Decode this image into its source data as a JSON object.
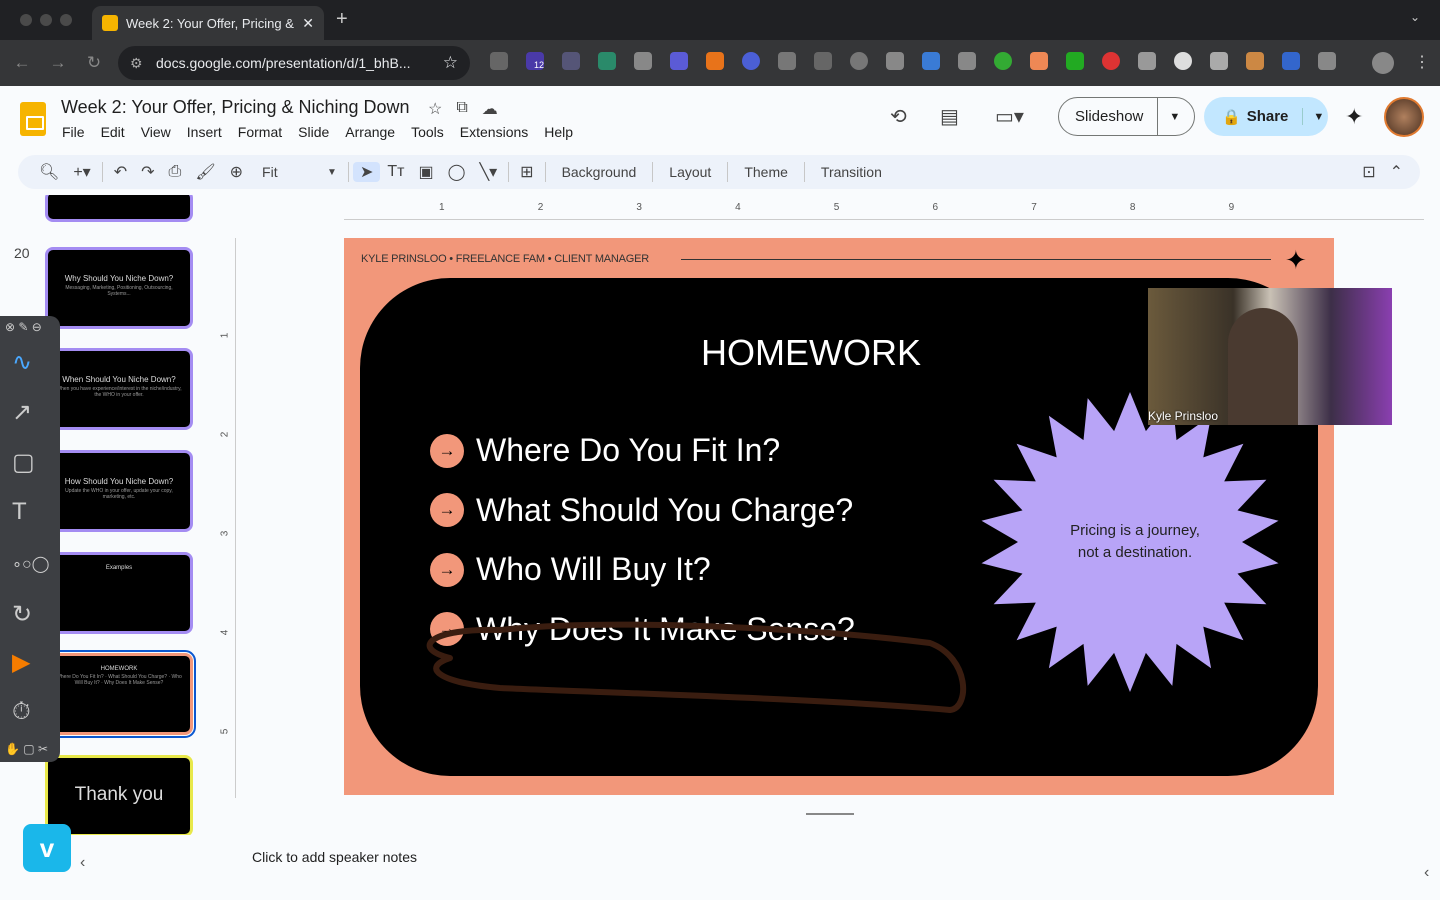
{
  "browser": {
    "tab_title": "Week 2: Your Offer, Pricing &",
    "url": "docs.google.com/presentation/d/1_bhB...",
    "extension_badge": "12"
  },
  "doc": {
    "title": "Week 2: Your Offer, Pricing & Niching Down",
    "menu": [
      "File",
      "Edit",
      "View",
      "Insert",
      "Format",
      "Slide",
      "Arrange",
      "Tools",
      "Extensions",
      "Help"
    ],
    "slideshow_label": "Slideshow",
    "share_label": "Share"
  },
  "toolbar": {
    "zoom": "Fit",
    "buttons": [
      "Background",
      "Layout",
      "Theme",
      "Transition"
    ]
  },
  "filmstrip": {
    "slide_number": "20",
    "thumbs": [
      {
        "title": "",
        "sub": ""
      },
      {
        "title": "Why Should You Niche Down?",
        "sub": "Messaging, Marketing, Positioning, Outsourcing, Systems..."
      },
      {
        "title": "When Should You Niche Down?",
        "sub": "When you have experience/interest in the niche/industry, the WHO in your offer."
      },
      {
        "title": "How Should You Niche Down?",
        "sub": "Update the WHO in your offer, update your copy, marketing, etc."
      },
      {
        "title": "Examples",
        "sub": ""
      },
      {
        "title": "HOMEWORK",
        "sub": "Where Do You Fit In? · What Should You Charge? · Who Will Buy It? · Why Does It Make Sense?"
      },
      {
        "title": "Thank you",
        "sub": ""
      }
    ]
  },
  "ruler": {
    "h": [
      "1",
      "2",
      "3",
      "4",
      "5",
      "6",
      "7",
      "8",
      "9"
    ],
    "v": [
      "1",
      "2",
      "3",
      "4",
      "5"
    ]
  },
  "slide": {
    "header": "KYLE PRINSLOO  •  FREELANCE FAM  •  CLIENT MANAGER",
    "title": "HOMEWORK",
    "items": [
      "Where Do You Fit In?",
      "What Should You Charge?",
      "Who Will Buy It?",
      "Why Does It Make Sense?"
    ],
    "quote": "Pricing is a journey, not a destination.",
    "colors": {
      "accent": "#f2977a",
      "burst": "#b8a4f7",
      "panel": "#000000"
    }
  },
  "webcam": {
    "name": "Kyle Prinsloo"
  },
  "notes": {
    "placeholder": "Click to add speaker notes"
  }
}
